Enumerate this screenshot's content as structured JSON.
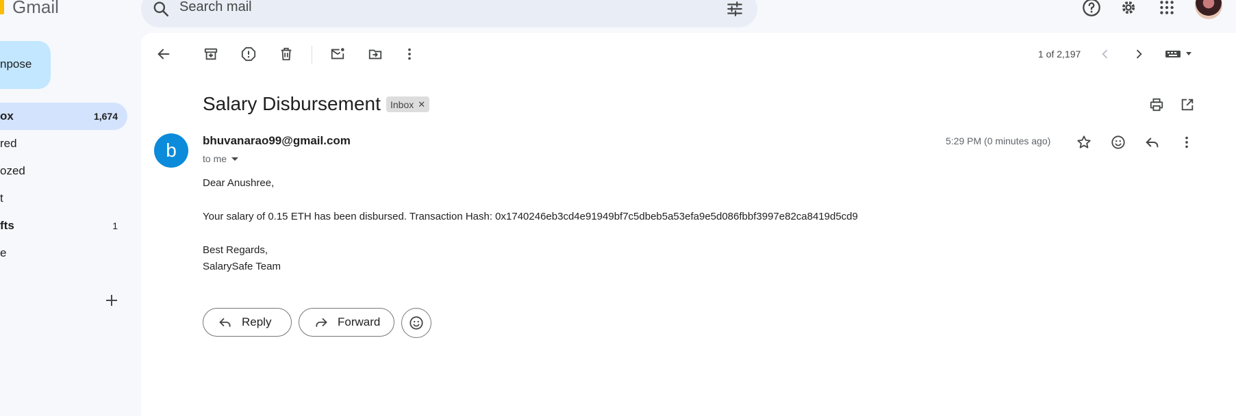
{
  "app": {
    "name": "Gmail"
  },
  "search": {
    "placeholder": "Search mail"
  },
  "compose": {
    "label": "npose"
  },
  "nav": [
    {
      "label": "ox",
      "count": "1,674",
      "active": true
    },
    {
      "label": "red",
      "count": ""
    },
    {
      "label": "ozed",
      "count": ""
    },
    {
      "label": "t",
      "count": ""
    },
    {
      "label": "fts",
      "count": "1",
      "bold": true
    },
    {
      "label": "e",
      "count": ""
    }
  ],
  "toolbar": {
    "icons": [
      "back-arrow-icon",
      "archive-icon",
      "report-spam-icon",
      "delete-icon",
      "mark-unread-icon",
      "move-to-icon",
      "more-vert-icon"
    ],
    "pager": "1 of 2,197"
  },
  "email": {
    "subject": "Salary Disbursement",
    "label": "Inbox",
    "sender_initial": "b",
    "sender": "bhuvanarao99@gmail.com",
    "to": "to me",
    "time": "5:29 PM (0 minutes ago)",
    "greeting": "Dear Anushree,",
    "message": "Your salary of 0.15 ETH has been disbursed. Transaction Hash: 0x1740246eb3cd4e91949bf7c5dbeb5a53efa9e5d086fbbf3997e82ca8419d5cd9",
    "signoff1": "Best Regards,",
    "signoff2": "SalarySafe Team"
  },
  "actions": {
    "reply": "Reply",
    "forward": "Forward"
  },
  "colors": {
    "accent": "#0b57d0",
    "active_nav": "#d3e3fd",
    "compose": "#c2e7ff",
    "avatar": "#0b8bd9"
  }
}
